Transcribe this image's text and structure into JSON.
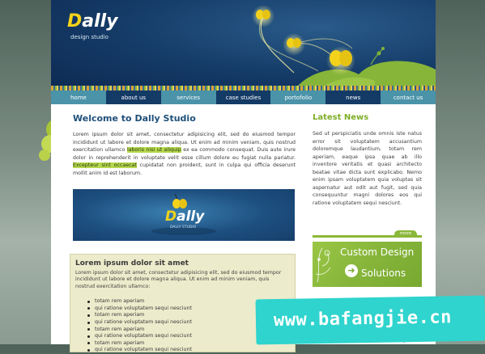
{
  "logo": {
    "name": "Dally",
    "subtitle": "design studio"
  },
  "nav": [
    {
      "label": "home",
      "dark": false
    },
    {
      "label": "about us",
      "dark": true
    },
    {
      "label": "services",
      "dark": false
    },
    {
      "label": "case studies",
      "dark": true
    },
    {
      "label": "portofolio",
      "dark": false
    },
    {
      "label": "news",
      "dark": true
    },
    {
      "label": "contact us",
      "dark": false
    }
  ],
  "main": {
    "title": "Welcome to Dally Studio",
    "para_before_hl1": "Lorem ipsum dolor sit amet, consectetur adipisicing elit, sed do eiusmod tempor incididunt ut labore et dolore magna aliqua. Ut enim ad minim veniam, quis nostrud exercitation ullamco ",
    "hl1": "laboris nisi ut aliquip",
    "para_between": " ex ea commodo consequat. Duis aute irure dolor in reprehenderit in voluptate velit esse cillum dolore eu fugiat nulla pariatur. ",
    "hl2": "Excepteur sint occaecat",
    "para_after": " cupidatat non proident, sunt in culpa qui officia deserunt mollit anim id est laborum."
  },
  "banner": {
    "logo": "Dally",
    "subtitle": "DALLY STUDIO"
  },
  "box": {
    "title": "Lorem ipsum dolor sit amet",
    "text": "Lorem ipsum dolor sit amet, consectetur adipisicing elit, sed do eiusmod tempor incididunt ut labore et dolore magna aliqua. Ut enim ad minim veniam, quis nostrud exercitation ullamco:",
    "items": [
      "totam rem aperiam",
      "qui ratione voluptatem sequi nesciunt",
      "totam rem aperiam",
      "qui ratione voluptatem sequi nesciunt",
      "totam rem aperiam",
      "qui ratione voluptatem sequi nesciunt",
      "totam rem aperiam",
      "qui ratione voluptatem sequi nesciunt"
    ]
  },
  "news": {
    "title": "Latest News",
    "text": "Sed ut perspiciatis unde omnis iste natus error sit voluptatem accusantium doloremque laudantium, totam rem aperiam, eaque ipsa quae ab illo inventore veritatis et quasi architecto beatae vitae dicta sunt explicabo. Nemo enim ipsam voluptatem quia voluptas sit aspernatur aut odit aut fugit, sed quia consequuntur magni dolores eos qui ratione voluptatem sequi nesciunt.",
    "more_label": "more",
    "bottom_words": [
      "natus",
      "error",
      "sit",
      "voluptatem"
    ]
  },
  "ad": {
    "line1": "Custom Design",
    "line2": "Solutions"
  },
  "watermark": "www.bafangjie.cn",
  "colors": {
    "nav_light": "#4a93a9",
    "nav_dark": "#143a66",
    "accent_green": "#8bb83a",
    "title_blue": "#1f4f7a"
  }
}
